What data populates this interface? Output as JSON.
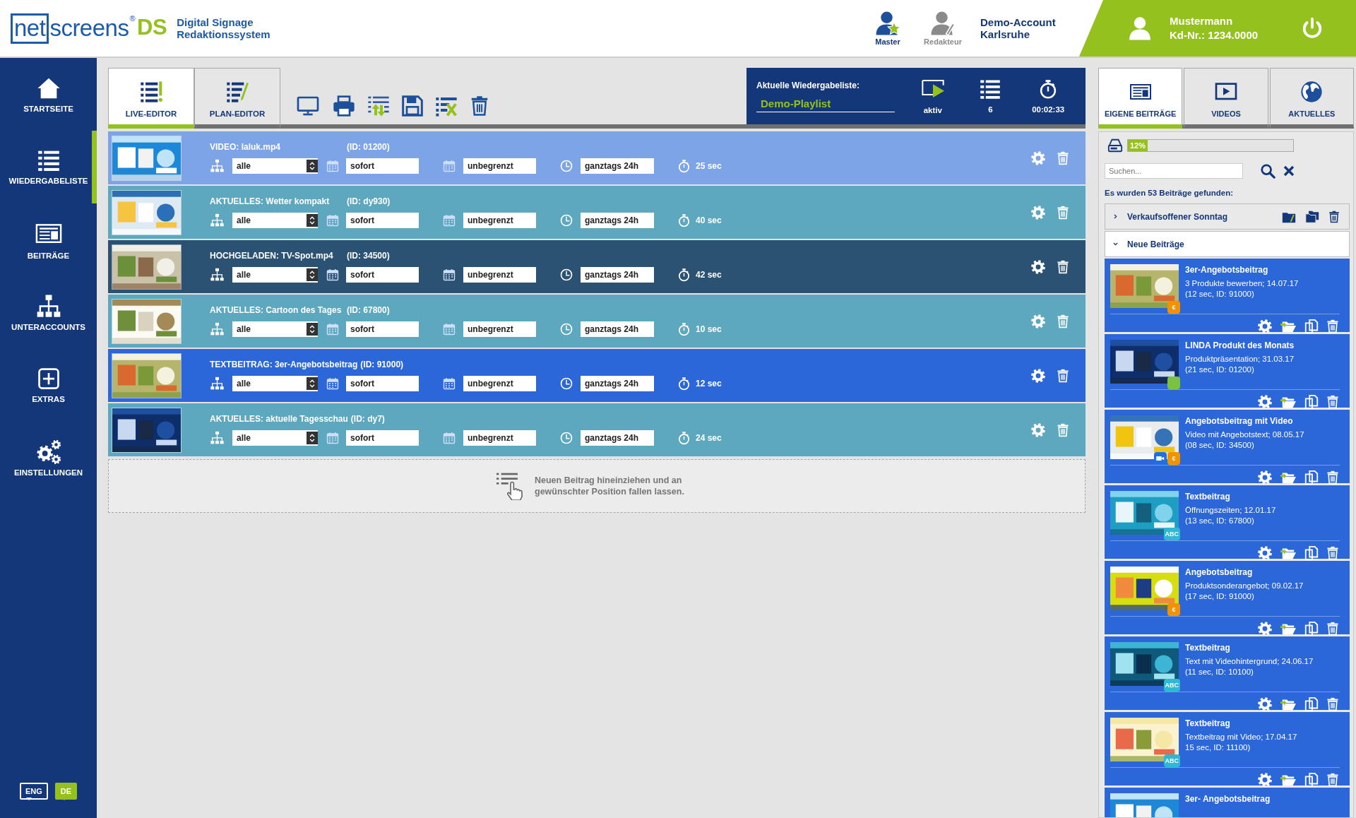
{
  "header": {
    "logo": {
      "boxed": "net",
      "rest": "screens",
      "mark": "®",
      "suffix": "DS",
      "tagline": [
        "Digital Signage",
        "Redaktionssystem"
      ]
    },
    "roles": [
      {
        "label": "Master",
        "selected": true
      },
      {
        "label": "Redakteur",
        "selected": false
      }
    ],
    "account": [
      "Demo-Account",
      "Karlsruhe"
    ],
    "user": {
      "name": "Mustermann",
      "customer_no": "Kd-Nr.: 1234.0000"
    }
  },
  "sidebar": {
    "items": [
      {
        "label": "STARTSEITE",
        "selected": false
      },
      {
        "label": "WIEDERGABELISTE",
        "selected": true
      },
      {
        "label": "BEITRÄGE",
        "selected": false
      },
      {
        "label": "UNTERACCOUNTS",
        "selected": false
      },
      {
        "label": "EXTRAS",
        "selected": false
      },
      {
        "label": "EINSTELLUNGEN",
        "selected": false
      }
    ],
    "languages": [
      {
        "label": "ENG",
        "selected": false
      },
      {
        "label": "DE",
        "selected": true
      }
    ]
  },
  "editor_tabs": [
    {
      "label": "LIVE-EDITOR",
      "selected": true
    },
    {
      "label": "PLAN-EDITOR",
      "selected": false
    }
  ],
  "current_playlist": {
    "heading": "Aktuelle Wiedergabeliste:",
    "name": "Demo-Playlist",
    "status": "aktiv",
    "count": "6",
    "duration": "00:02:33"
  },
  "playlist": {
    "rows": [
      {
        "title": "VIDEO: laluk.mp4",
        "id": "(ID: 01200)",
        "target": "alle",
        "start": "sofort",
        "end": "unbegrenzt",
        "time": "ganztags 24h",
        "duration": "25 sec",
        "color": "#7ea4e8"
      },
      {
        "title": "AKTUELLES: Wetter kompakt",
        "id": "(ID: dy930)",
        "target": "alle",
        "start": "sofort",
        "end": "unbegrenzt",
        "time": "ganztags 24h",
        "duration": "40 sec",
        "color": "#5ea8bf"
      },
      {
        "title": "HOCHGELADEN: TV-Spot.mp4",
        "id": "(ID: 34500)",
        "target": "alle",
        "start": "sofort",
        "end": "unbegrenzt",
        "time": "ganztags 24h",
        "duration": "42 sec",
        "color": "#2b5173"
      },
      {
        "title": "AKTUELLES: Cartoon des Tages",
        "id": "(ID: 67800)",
        "target": "alle",
        "start": "sofort",
        "end": "unbegrenzt",
        "time": "ganztags 24h",
        "duration": "10 sec",
        "color": "#5ea8bf"
      },
      {
        "title": "TEXTBEITRAG: 3er-Angebotsbeitrag",
        "id": "(ID: 91000)",
        "target": "alle",
        "start": "sofort",
        "end": "unbegrenzt",
        "time": "ganztags 24h",
        "duration": "12 sec",
        "color": "#2b67d9"
      },
      {
        "title": "AKTUELLES: aktuelle Tagesschau",
        "id": "(ID: dy7)",
        "target": "alle",
        "start": "sofort",
        "end": "unbegrenzt",
        "time": "ganztags 24h",
        "duration": "24 sec",
        "color": "#5ea8bf"
      }
    ]
  },
  "drop_hint": "Neuen Beitrag hineinziehen und an gewünschter Position fallen lassen.",
  "library": {
    "tabs": [
      {
        "label": "EIGENE BEITRÄGE",
        "selected": true
      },
      {
        "label": "VIDEOS",
        "selected": false
      },
      {
        "label": "AKTUELLES",
        "selected": false
      }
    ],
    "storage": {
      "level": 0.12,
      "reading": "12%"
    },
    "search": {
      "placeholder": "Suchen..."
    },
    "result_count": "Es wurden 53 Beiträge gefunden:",
    "folders": [
      {
        "name": "Verkaufsoffener Sonntag",
        "expanded": false
      },
      {
        "name": "Neue Beiträge",
        "expanded": true,
        "children": [
          {
            "title": "3er-Angebotsbeitrag",
            "line1": "3 Produkte bewerben; 14.07.17",
            "line2": "(12 sec, ID: 91000)",
            "badges": [
              {
                "kind": "label",
                "label": "€",
                "color": "#f39200"
              }
            ]
          },
          {
            "title": "LINDA Produkt des Monats",
            "line1": "Produktpräsentation; 31.03.17",
            "line2": "(21 sec, ID: 01200)",
            "badges": [
              {
                "kind": "blank",
                "color": "#7cc242"
              }
            ]
          },
          {
            "title": "Angebotsbeitrag mit Video",
            "line1": "Video mit Angebotstext; 08.05.17",
            "line2": "(08 sec, ID: 34500)",
            "badges": [
              {
                "kind": "video",
                "color": "#1e6fe0"
              },
              {
                "kind": "label",
                "label": "€",
                "color": "#f39200"
              }
            ]
          },
          {
            "title": "Textbeitrag",
            "line1": "Öffnungszeiten; 12.01.17",
            "line2": "(13 sec, ID: 67800)",
            "badges": [
              {
                "kind": "label",
                "label": "ABC",
                "color": "#2fb8d6"
              }
            ]
          },
          {
            "title": "Angebotsbeitrag",
            "line1": "Produktsonderangebot; 09.02.17",
            "line2": "(17 sec, ID: 91000)",
            "badges": [
              {
                "kind": "label",
                "label": "€",
                "color": "#f39200"
              }
            ]
          },
          {
            "title": "Textbeitrag",
            "line1": "Text mit Videohintergrund; 24.06.17",
            "line2": "(11 sec, ID: 10100)",
            "badges": [
              {
                "kind": "label",
                "label": "ABC",
                "color": "#2fb8d6"
              }
            ]
          },
          {
            "title": "Textbeitrag",
            "line1": "Textbeitrag mit Video; 17.04.17",
            "line2": "15 sec, ID: 11100)",
            "badges": [
              {
                "kind": "label",
                "label": "ABC",
                "color": "#2fb8d6"
              }
            ]
          },
          {
            "title": "3er- Angebotsbeitrag"
          }
        ]
      }
    ]
  }
}
